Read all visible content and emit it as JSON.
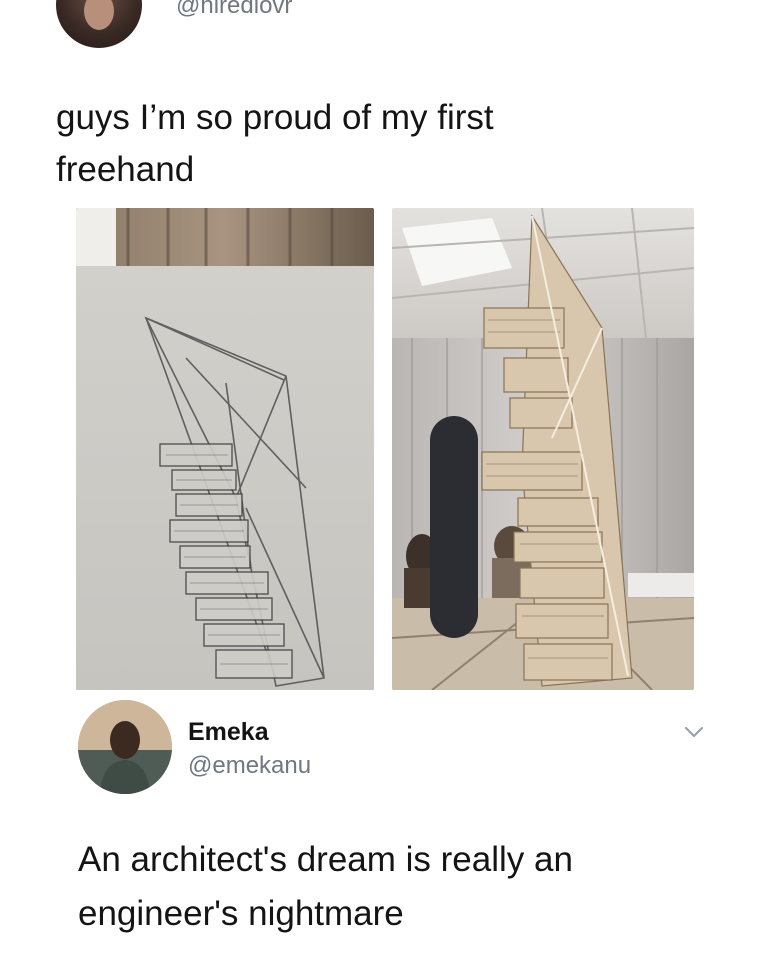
{
  "tweet": {
    "handle": "@hiredlovr",
    "text_line1": "guys I’m so proud of my first",
    "text_line2": "freehand",
    "avatar_icon": "profile-photo"
  },
  "media": {
    "left_icon": "pencil-sketch-photo",
    "right_icon": "architectural-model-photo"
  },
  "reply": {
    "name": "Emeka",
    "handle": "@emekanu",
    "text_line1": "An architect's dream is really an",
    "text_line2": "engineer's nightmare",
    "menu_icon": "chevron-down-icon"
  }
}
